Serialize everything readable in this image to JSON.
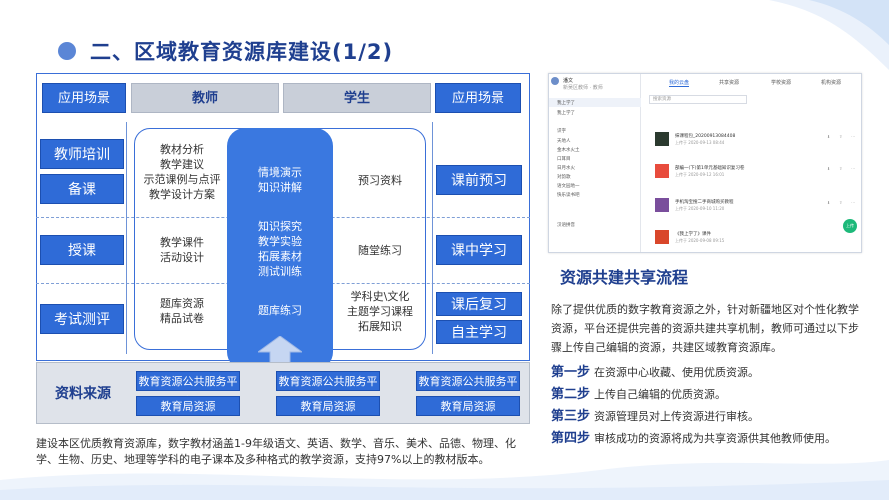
{
  "title": "二、区域教育资源库建设(1/2)",
  "diagram": {
    "headers": {
      "left": "应用场景",
      "teacher": "教师",
      "student": "学生",
      "right": "应用场景"
    },
    "left_scenes": [
      "教师培训",
      "备课",
      "授课",
      "考试测评"
    ],
    "right_scenes": [
      "课前预习",
      "课中学习",
      "课后复习",
      "自主学习"
    ],
    "teacher_rows": [
      [
        "教材分析",
        "教学建议",
        "示范课例与点评",
        "教学设计方案"
      ],
      [
        "教学课件",
        "活动设计"
      ],
      [
        "题库资源",
        "精品试卷"
      ]
    ],
    "shared_rows": [
      [
        "情境演示",
        "知识讲解"
      ],
      [
        "知识探究",
        "教学实验",
        "拓展素材",
        "测试训练"
      ],
      [
        "题库练习"
      ]
    ],
    "student_rows": [
      [
        "预习资料"
      ],
      [
        "随堂练习"
      ],
      [
        "学科史\\文化",
        "主题学习课程",
        "拓展知识"
      ]
    ],
    "source": {
      "label": "资料来源",
      "platforms": [
        "教育资源公共服务平台",
        "教育资源公共服务平台",
        "教育资源公共服务平台"
      ],
      "bureaus": [
        "教育局资源",
        "教育局资源",
        "教育局资源"
      ]
    },
    "note": "建设本区优质教育资源库，数字教材涵盖1-9年级语文、英语、数学、音乐、美术、品德、物理、化学、生物、历史、地理等学科的电子课本及多种格式的教学资源，支持97%以上的教材版本。"
  },
  "screenshot": {
    "user_name": "潘文",
    "user_sub": "新吴区教师 · 教师",
    "tabs": [
      "我的云盘",
      "共享资源",
      "学校资源",
      "机构资源"
    ],
    "search_placeholder": "搜索资源",
    "sidebar": [
      "我上学了",
      "我上学了",
      "识字",
      "天地人",
      "金木水火土",
      "口耳目",
      "日月水火",
      "对韵歌",
      "语文园地一",
      "快乐读书吧",
      "汉语拼音"
    ],
    "files": [
      {
        "title": "抹课程包_20200913084408",
        "sub": "上传于 2020-09-13 08:44"
      },
      {
        "title": "部编一(下)第1单元基础知识复习卷",
        "sub": "上传于 2020-09-12 16:01"
      },
      {
        "title": "手机淘宝搜二手商城购买教程",
        "sub": "上传于 2020-09-10 11:20"
      },
      {
        "title": "《我上学了》课件",
        "sub": "上传于 2020-09-08 09:15"
      }
    ],
    "fab": "上传"
  },
  "flow": {
    "title": "资源共建共享流程",
    "intro": "除了提供优质的数字教育资源之外，针对新疆地区对个性化教学资源，平台还提供完善的资源共建共享机制，教师可通过以下步骤上传自己编辑的资源，共建区域教育资源库。",
    "steps": [
      {
        "label": "第一步",
        "text": "在资源中心收藏、使用优质资源。"
      },
      {
        "label": "第二步",
        "text": "上传自己编辑的优质资源。"
      },
      {
        "label": "第三步",
        "text": "资源管理员对上传资源进行审核。"
      },
      {
        "label": "第四步",
        "text": "审核成功的资源将成为共享资源供其他教师使用。"
      }
    ]
  },
  "colors": {
    "accent": "#2f6bd7",
    "title": "#1f3f8f",
    "gray": "#c9cfd9"
  }
}
